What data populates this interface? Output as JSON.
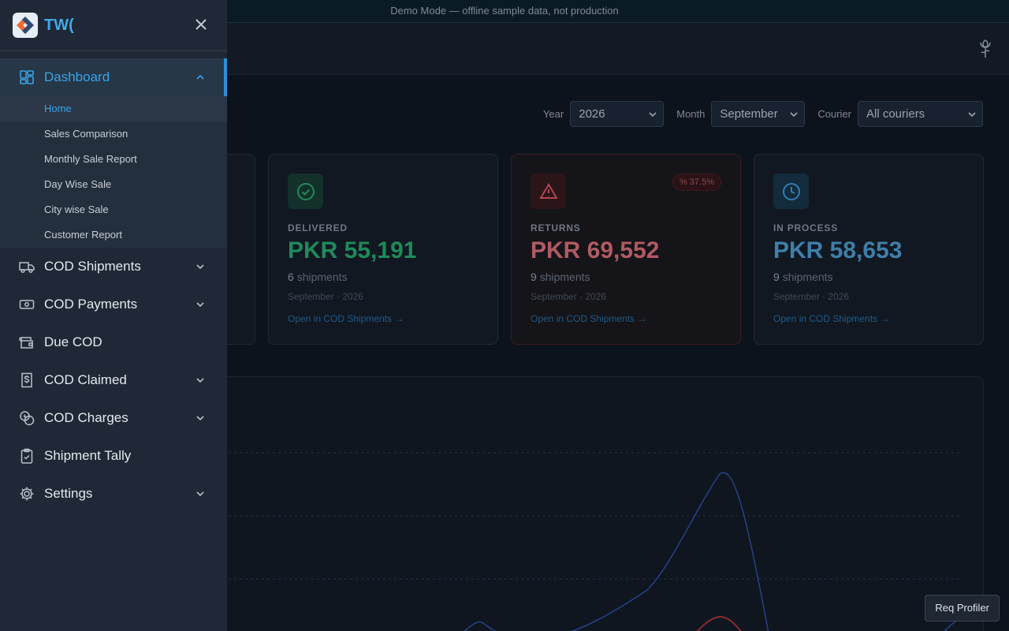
{
  "demo_banner": "Demo Mode — offline sample data, not production",
  "filters": {
    "year_label": "Year",
    "year_value": "2026",
    "month_label": "Month",
    "month_value": "September",
    "courier_label": "Courier",
    "courier_value": "All couriers"
  },
  "cards": [
    {
      "label": "DELIVERED",
      "amount": "PKR 55,191",
      "count": "6",
      "count_suffix": "shipments",
      "period": "September · 2026",
      "link": "Open in COD Shipments →",
      "color": "#1f8a5a"
    },
    {
      "label": "RETURNS",
      "amount": "PKR 69,552",
      "count": "9",
      "count_suffix": "shipments",
      "period": "September · 2026",
      "link": "Open in COD Shipments →",
      "badge": "37.5%",
      "color": "#b05a62"
    },
    {
      "label": "IN PROCESS",
      "amount": "PKR 58,653",
      "count": "9",
      "count_suffix": "shipments",
      "period": "September · 2026",
      "link": "Open in COD Shipments →",
      "color": "#3f7fa8"
    }
  ],
  "profiler_button": "Req Profiler",
  "sidebar": {
    "brand": "TW(",
    "items": [
      {
        "label": "Dashboard",
        "icon": "dashboard-icon",
        "expanded": true
      },
      {
        "label": "COD Shipments",
        "icon": "truck-icon"
      },
      {
        "label": "COD Payments",
        "icon": "banknote-icon"
      },
      {
        "label": "Due COD",
        "icon": "wallet-icon"
      },
      {
        "label": "COD Claimed",
        "icon": "receipt-dollar-icon"
      },
      {
        "label": "COD Charges",
        "icon": "coins-icon"
      },
      {
        "label": "Shipment Tally",
        "icon": "clipboard-check-icon"
      },
      {
        "label": "Settings",
        "icon": "gear-icon"
      }
    ],
    "dashboard_sub": [
      "Home",
      "Sales Comparison",
      "Monthly Sale Report",
      "Day Wise Sale",
      "City wise Sale",
      "Customer Report"
    ]
  },
  "colors": {
    "accent": "#3aa3e6",
    "delivered": "#1f8a5a",
    "returns": "#b05a62",
    "in_process": "#3f7fa8"
  }
}
